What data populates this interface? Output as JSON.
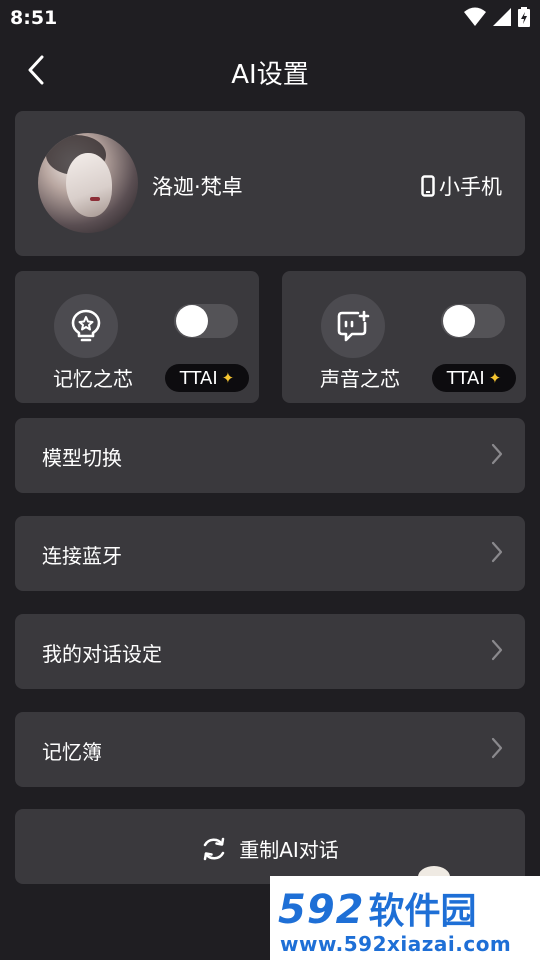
{
  "status_bar": {
    "time": "8:51"
  },
  "header": {
    "title": "AI设置"
  },
  "profile": {
    "name": "洛迦·梵卓",
    "device": "小手机"
  },
  "features": [
    {
      "label": "记忆之芯",
      "badge": "TTAI",
      "enabled": false
    },
    {
      "label": "声音之芯",
      "badge": "TTAI",
      "enabled": false
    }
  ],
  "menu": [
    {
      "label": "模型切换"
    },
    {
      "label": "连接蓝牙"
    },
    {
      "label": "我的对话设定"
    },
    {
      "label": "记忆簿"
    }
  ],
  "reset": {
    "label": "重制AI对话"
  },
  "watermark": {
    "logo_number": "592",
    "logo_text": "软件园",
    "url": "www.592xiazai.com"
  },
  "colors": {
    "background": "#1f1e22",
    "card": "#3a393d",
    "badge_star": "#f5c430",
    "watermark_blue": "#1e6fd6"
  }
}
